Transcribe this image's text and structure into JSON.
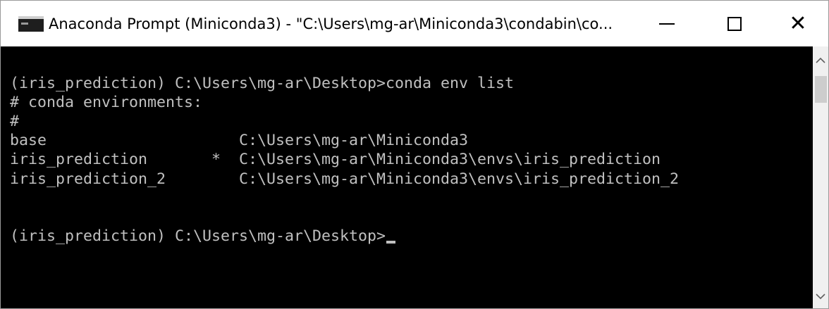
{
  "window": {
    "title": "Anaconda Prompt (Miniconda3) - \"C:\\Users\\mg-ar\\Miniconda3\\condabin\\co..."
  },
  "controls": {
    "minimize": "—",
    "close": "✕"
  },
  "console": {
    "lines": [
      "",
      "(iris_prediction) C:\\Users\\mg-ar\\Desktop>conda env list",
      "# conda environments:",
      "#",
      "base                     C:\\Users\\mg-ar\\Miniconda3",
      "iris_prediction       *  C:\\Users\\mg-ar\\Miniconda3\\envs\\iris_prediction",
      "iris_prediction_2        C:\\Users\\mg-ar\\Miniconda3\\envs\\iris_prediction_2",
      "",
      "",
      "(iris_prediction) C:\\Users\\mg-ar\\Desktop>"
    ]
  },
  "scrollbar": {
    "up": "^",
    "down": "v"
  },
  "colors": {
    "console_bg": "#000000",
    "console_text": "#c0c0c0",
    "titlebar_bg": "#ffffff"
  }
}
